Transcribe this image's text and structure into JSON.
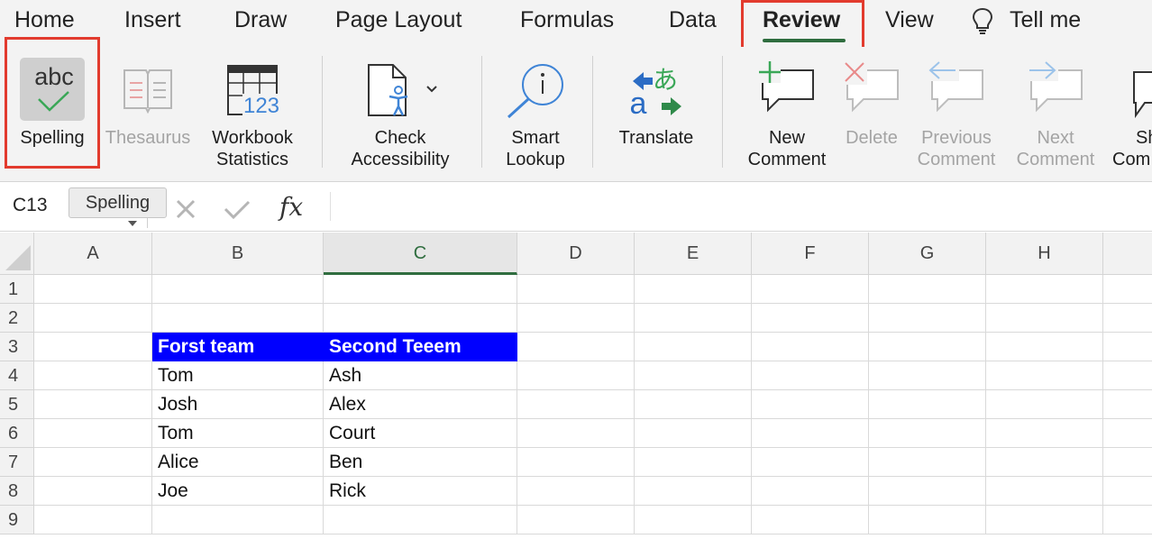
{
  "tabs": [
    {
      "label": "Home"
    },
    {
      "label": "Insert"
    },
    {
      "label": "Draw"
    },
    {
      "label": "Page Layout"
    },
    {
      "label": "Formulas"
    },
    {
      "label": "Data"
    },
    {
      "label": "Review",
      "active": true
    },
    {
      "label": "View"
    },
    {
      "label": "Tell me"
    }
  ],
  "ribbon": {
    "spelling": {
      "icon_text": "abc",
      "label": "Spelling"
    },
    "thesaurus": {
      "label": "Thesaurus"
    },
    "workbook_statistics": {
      "icon_text": "123",
      "line1": "Workbook",
      "line2": "Statistics"
    },
    "check_accessibility": {
      "line1": "Check",
      "line2": "Accessibility"
    },
    "smart_lookup": {
      "line1": "Smart",
      "line2": "Lookup"
    },
    "translate": {
      "icon_glyph": "あ",
      "icon_letter": "a",
      "label": "Translate"
    },
    "new_comment": {
      "line1": "New",
      "line2": "Comment"
    },
    "delete": {
      "label": "Delete"
    },
    "previous_comment": {
      "line1": "Previous",
      "line2": "Comment"
    },
    "next_comment": {
      "line1": "Next",
      "line2": "Comment"
    },
    "show_comments": {
      "line1": "Sh",
      "line2": "Com"
    }
  },
  "formula_bar": {
    "name_box": "C13",
    "tooltip": "Spelling",
    "fx": "fx",
    "formula": ""
  },
  "grid": {
    "columns": [
      "A",
      "B",
      "C",
      "D",
      "E",
      "F",
      "G",
      "H"
    ],
    "selected_column": "C",
    "rows": [
      "1",
      "2",
      "3",
      "4",
      "5",
      "6",
      "7",
      "8",
      "9"
    ],
    "header_row": {
      "B": "Forst team",
      "C": "Second Teeem"
    },
    "data": [
      {
        "B": "Tom",
        "C": "Ash"
      },
      {
        "B": "Josh",
        "C": "Alex"
      },
      {
        "B": "Tom",
        "C": "Court"
      },
      {
        "B": "Alice",
        "C": "Ben"
      },
      {
        "B": "Joe",
        "C": "Rick"
      }
    ]
  },
  "colors": {
    "accent_green": "#2f6d3f",
    "highlight_red": "#e23b2e",
    "table_header_blue": "#0000ff",
    "comment_plus_green": "#3aa757",
    "delete_red": "#e88a8a",
    "nav_arrow_blue": "#9cc3ea"
  }
}
